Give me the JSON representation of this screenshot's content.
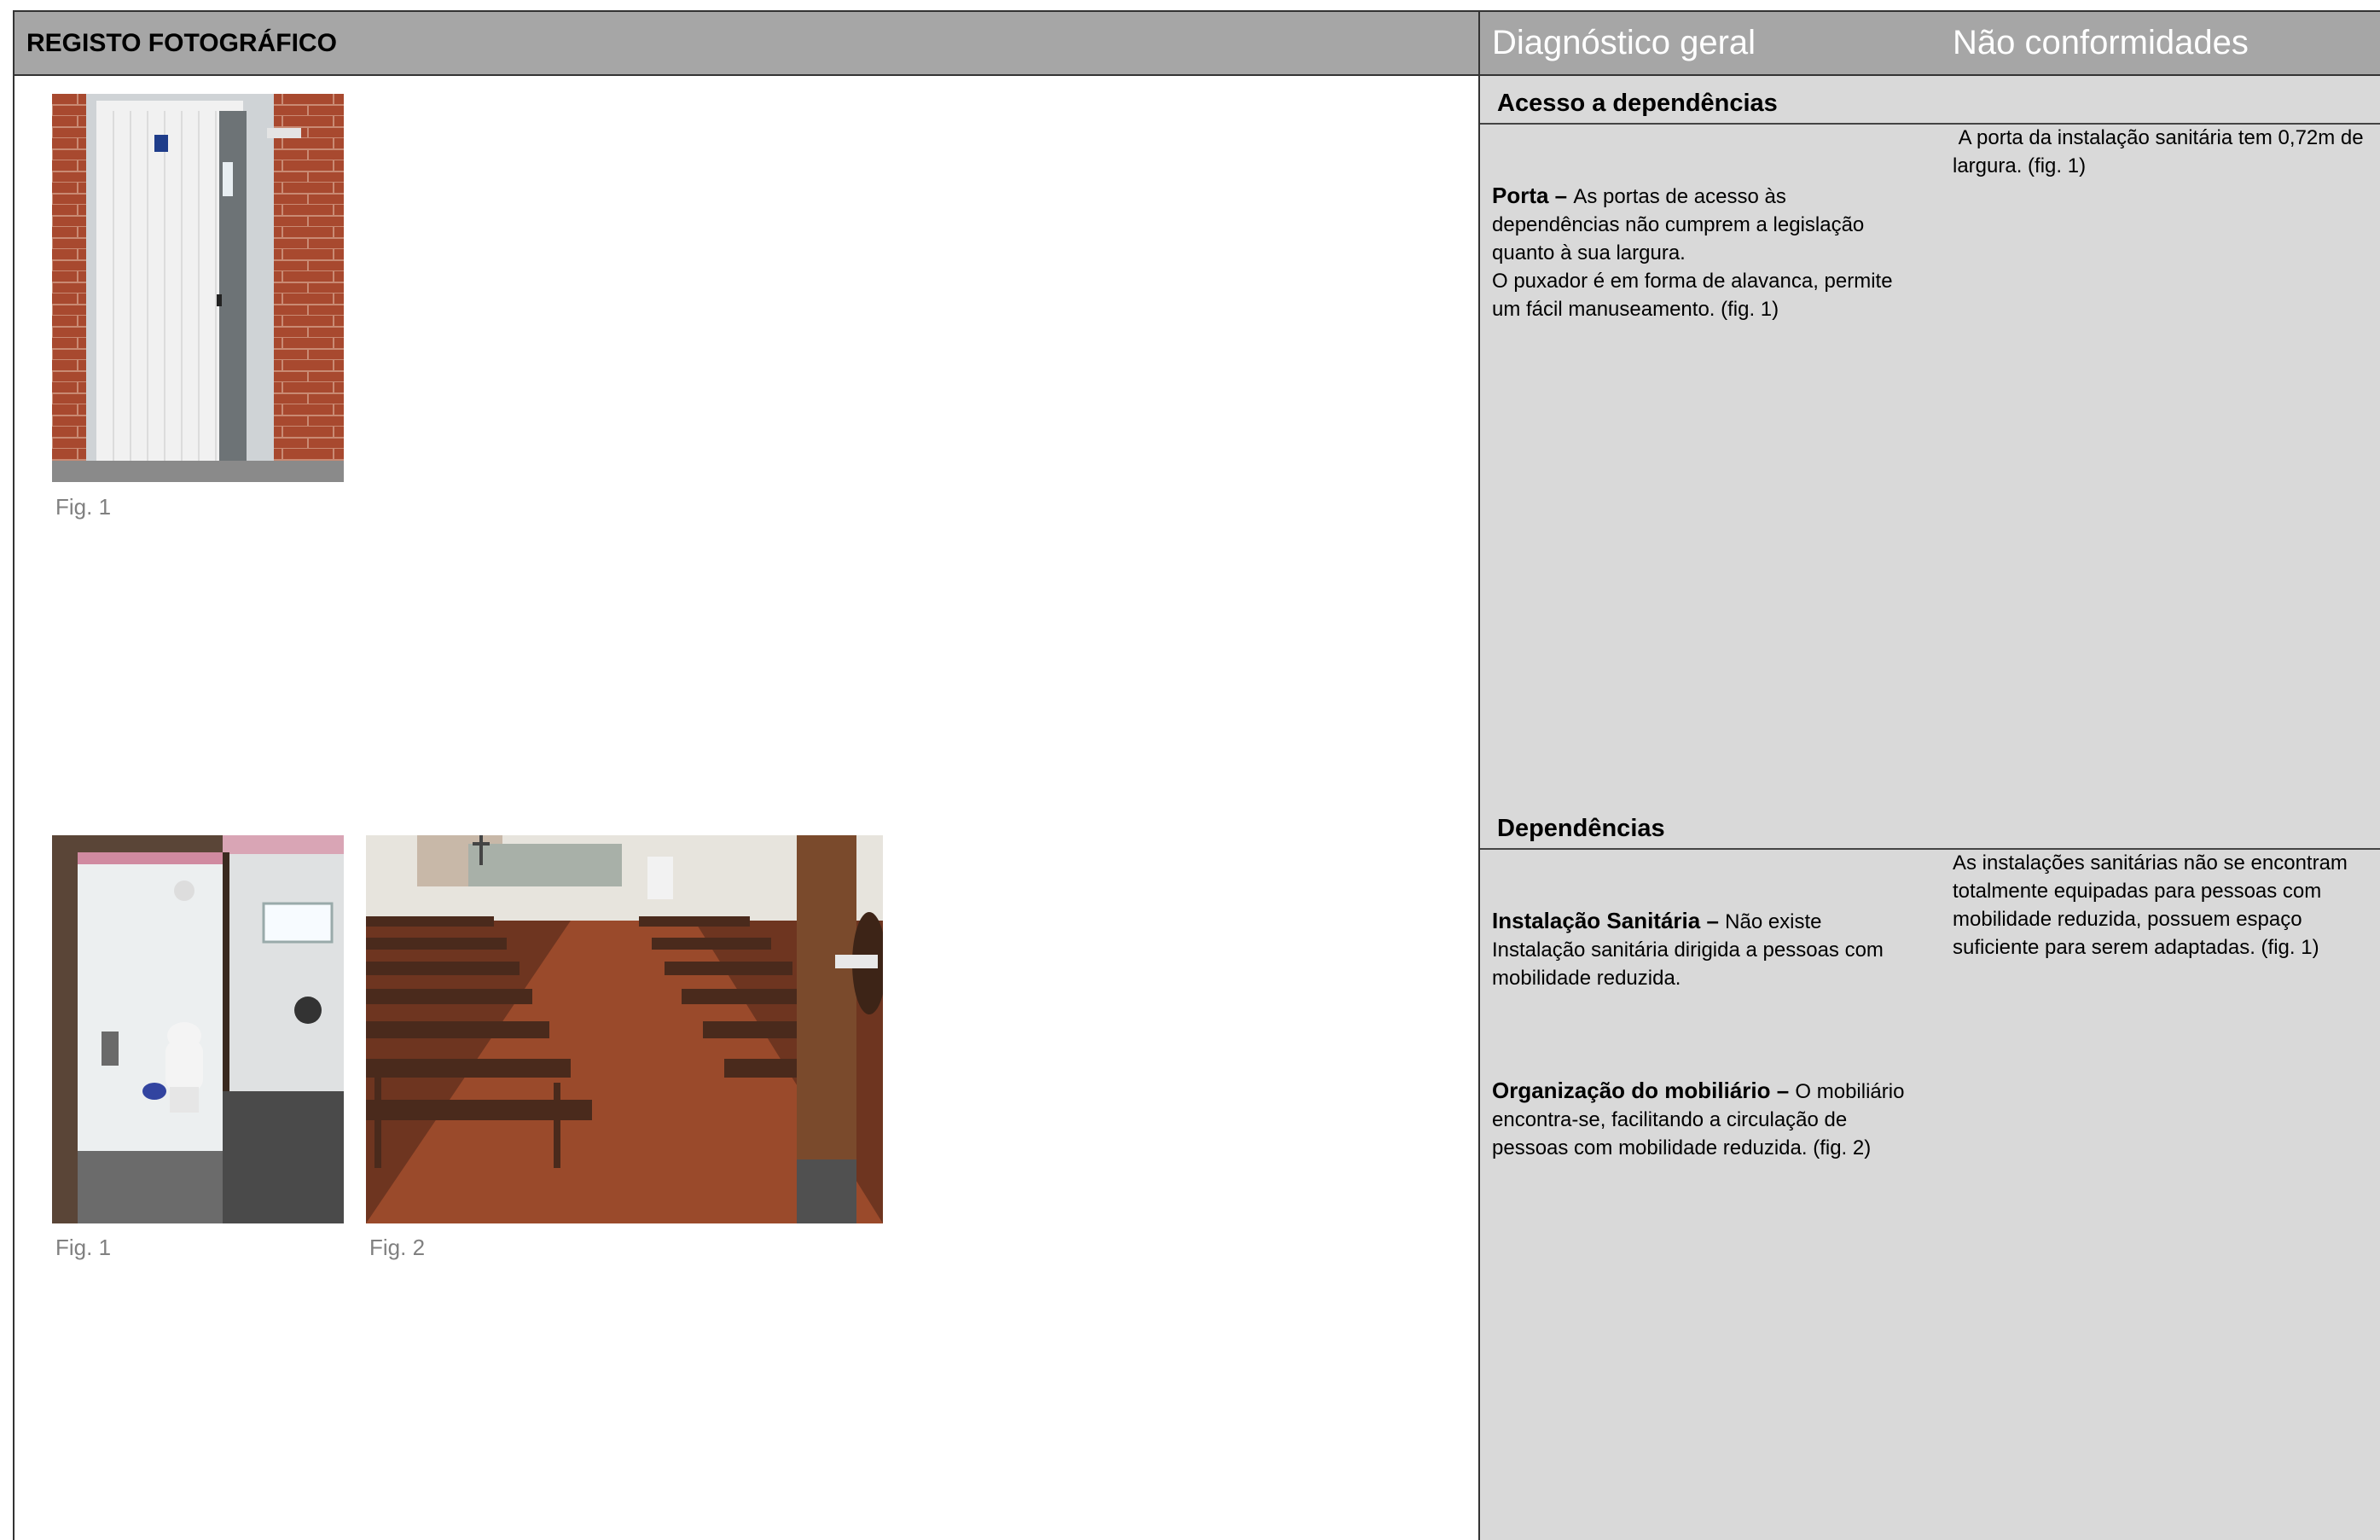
{
  "header": {
    "title": "REGISTO FOTOGRÁFICO",
    "col_diagnostico": "Diagnóstico geral",
    "col_nao_conformidades": "Não conformidades"
  },
  "sections": [
    {
      "title": "Acesso a dependências",
      "figures": [
        {
          "caption": "Fig. 1",
          "icon": "door-photo"
        }
      ],
      "diagnostico": [
        {
          "bold": "Porta – ",
          "text": "As portas de acesso às dependências não cumprem a legislação quanto à sua largura.\nO puxador é em forma de alavanca, permite um fácil manuseamento. (fig. 1)"
        }
      ],
      "nao_conformidades": " A porta da instalação sanitária tem 0,72m de largura. (fig. 1)"
    },
    {
      "title": "Dependências",
      "figures": [
        {
          "caption": "Fig. 1",
          "icon": "toilet-photo"
        },
        {
          "caption": "Fig. 2",
          "icon": "church-pews-photo"
        }
      ],
      "diagnostico": [
        {
          "bold": "Instalação Sanitária – ",
          "text": "Não existe Instalação sanitária dirigida a pessoas com mobilidade reduzida."
        },
        {
          "bold": "Organização do mobiliário – ",
          "text": "O mobiliário encontra-se, facilitando a circulação de pessoas com mobilidade reduzida. (fig. 2)"
        }
      ],
      "nao_conformidades": "As instalações sanitárias não se encontram totalmente equipadas para pessoas com mobilidade reduzida, possuem espaço suficiente para serem adaptadas. (fig. 1)"
    }
  ]
}
